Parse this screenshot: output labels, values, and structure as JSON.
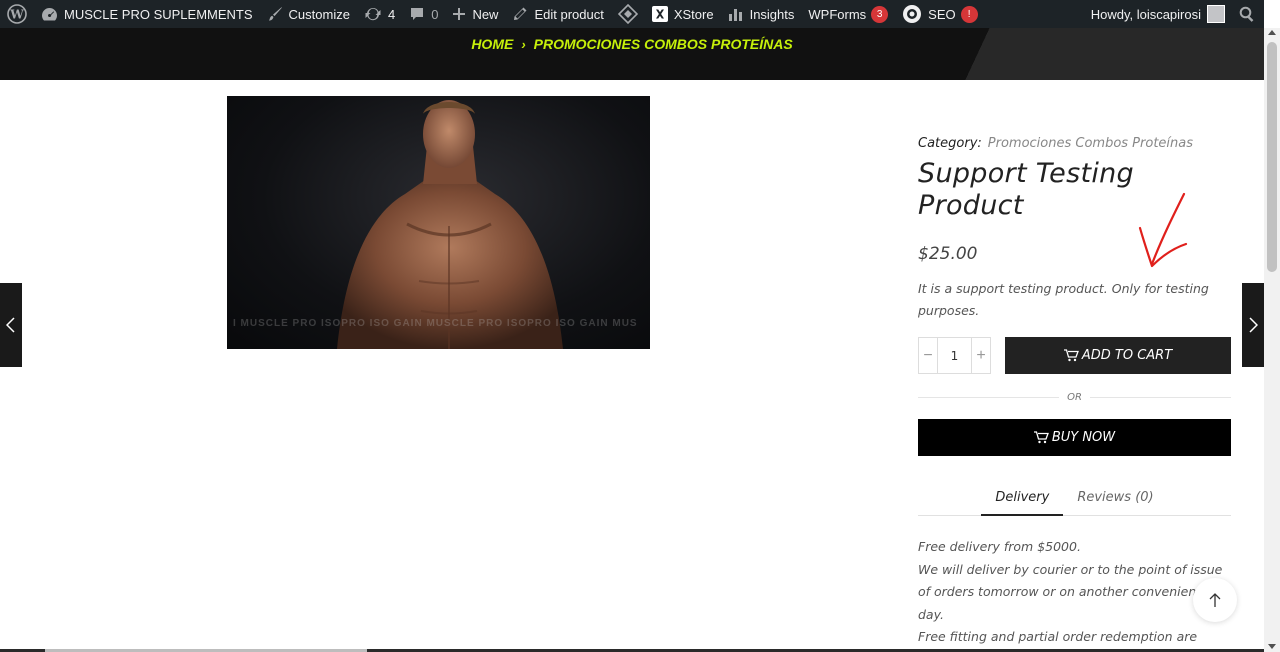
{
  "adminbar": {
    "site_name": "MUSCLE PRO SUPLEMMENTS",
    "customize": "Customize",
    "updates_count": "4",
    "comments_count": "0",
    "new": "New",
    "edit_product": "Edit product",
    "xstore": "XStore",
    "insights": "Insights",
    "wpforms": "WPForms",
    "wpforms_badge": "3",
    "seo": "SEO",
    "seo_badge": "!",
    "howdy": "Howdy, loiscapirosi"
  },
  "breadcrumb": {
    "home": "HOME",
    "current": "PROMOCIONES COMBOS PROTEÍNAS"
  },
  "product": {
    "image_watermark": "I MUSCLE PRO ISOPRO   ISO GAIN MUSCLE PRO ISOPRO   ISO GAIN MUS",
    "category_label": "Category:",
    "category_value": "Promociones Combos Proteínas",
    "title": "Support Testing Product",
    "price": "$25.00",
    "short_description": "It is a support testing product. Only for testing purposes.",
    "quantity": "1",
    "add_to_cart": "ADD TO CART",
    "or": "OR",
    "buy_now": "BUY NOW"
  },
  "tabs": [
    {
      "label": "Delivery",
      "active": true
    },
    {
      "label": "Reviews (0)",
      "active": false
    }
  ],
  "delivery_text": {
    "line1": "Free delivery from $5000.",
    "line2": "We will deliver by courier or to the point of issue of orders tomorrow or on another convenient day.",
    "line3": "Free fitting and partial order redemption are available."
  },
  "colors": {
    "accent": "#c6f00a",
    "annotation": "#e0201c",
    "button_dark": "#222222"
  }
}
